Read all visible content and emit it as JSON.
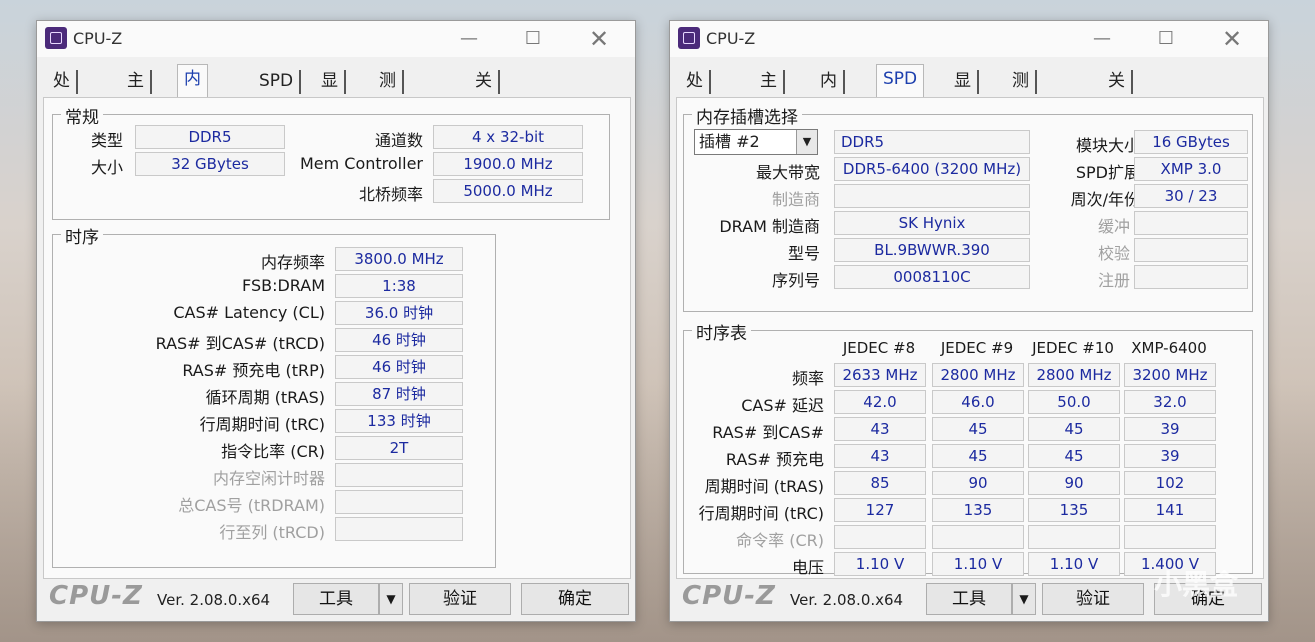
{
  "app_title": "CPU-Z",
  "tabs": [
    "处理器",
    "主板",
    "内存",
    "SPD",
    "显卡",
    "测試分數",
    "关于"
  ],
  "footer": {
    "logo": "CPU-Z",
    "version": "Ver. 2.08.0.x64",
    "tools": "工具",
    "validate": "验证",
    "ok": "确定"
  },
  "watermark": "小黑盒",
  "left": {
    "general_title": "常规",
    "type_label": "类型",
    "type_value": "DDR5",
    "size_label": "大小",
    "size_value": "32 GBytes",
    "channels_label": "通道数",
    "channels_value": "4 x 32-bit",
    "memctrl_label": "Mem Controller",
    "memctrl_value": "1900.0 MHz",
    "nb_label": "北桥频率",
    "nb_value": "5000.0 MHz",
    "timings_title": "时序",
    "timings": [
      {
        "label": "内存频率",
        "value": "3800.0 MHz",
        "dim": false
      },
      {
        "label": "FSB:DRAM",
        "value": "1:38",
        "dim": false
      },
      {
        "label": "CAS# Latency (CL)",
        "value": "36.0 时钟",
        "dim": false
      },
      {
        "label": "RAS# 到CAS# (tRCD)",
        "value": "46 时钟",
        "dim": false
      },
      {
        "label": "RAS# 预充电 (tRP)",
        "value": "46 时钟",
        "dim": false
      },
      {
        "label": "循环周期 (tRAS)",
        "value": "87 时钟",
        "dim": false
      },
      {
        "label": "行周期时间 (tRC)",
        "value": "133 时钟",
        "dim": false
      },
      {
        "label": "指令比率 (CR)",
        "value": "2T",
        "dim": false
      },
      {
        "label": "内存空闲计时器",
        "value": "",
        "dim": true
      },
      {
        "label": "总CAS号 (tRDRAM)",
        "value": "",
        "dim": true
      },
      {
        "label": "行至列 (tRCD)",
        "value": "",
        "dim": true
      }
    ]
  },
  "right": {
    "slot_title": "内存插槽选择",
    "slot_selected": "插槽 #2",
    "module_type": "DDR5",
    "module_size_label": "模块大小",
    "module_size_value": "16 GBytes",
    "max_bw_label": "最大带宽",
    "max_bw_value": "DDR5-6400 (3200 MHz)",
    "spd_ext_label": "SPD扩展",
    "spd_ext_value": "XMP 3.0",
    "maker_label": "制造商",
    "maker_value": "",
    "week_label": "周次/年份",
    "week_value": "30 / 23",
    "dram_maker_label": "DRAM 制造商",
    "dram_maker_value": "SK Hynix",
    "buffer_label": "缓冲",
    "buffer_value": "",
    "model_label": "型号",
    "model_value": "BL.9BWWR.390",
    "check_label": "校验",
    "check_value": "",
    "serial_label": "序列号",
    "serial_value": "0008110C",
    "reg_label": "注册",
    "reg_value": "",
    "timing_table_title": "时序表",
    "columns": [
      "JEDEC #8",
      "JEDEC #9",
      "JEDEC #10",
      "XMP-6400"
    ],
    "rows": [
      {
        "label": "频率",
        "values": [
          "2633 MHz",
          "2800 MHz",
          "2800 MHz",
          "3200 MHz"
        ],
        "dim": false
      },
      {
        "label": "CAS# 延迟",
        "values": [
          "42.0",
          "46.0",
          "50.0",
          "32.0"
        ],
        "dim": false
      },
      {
        "label": "RAS# 到CAS#",
        "values": [
          "43",
          "45",
          "45",
          "39"
        ],
        "dim": false
      },
      {
        "label": "RAS# 预充电",
        "values": [
          "43",
          "45",
          "45",
          "39"
        ],
        "dim": false
      },
      {
        "label": "周期时间 (tRAS)",
        "values": [
          "85",
          "90",
          "90",
          "102"
        ],
        "dim": false
      },
      {
        "label": "行周期时间 (tRC)",
        "values": [
          "127",
          "135",
          "135",
          "141"
        ],
        "dim": false
      },
      {
        "label": "命令率 (CR)",
        "values": [
          "",
          "",
          "",
          ""
        ],
        "dim": true
      },
      {
        "label": "电压",
        "values": [
          "1.10 V",
          "1.10 V",
          "1.10 V",
          "1.400 V"
        ],
        "dim": false
      }
    ]
  }
}
